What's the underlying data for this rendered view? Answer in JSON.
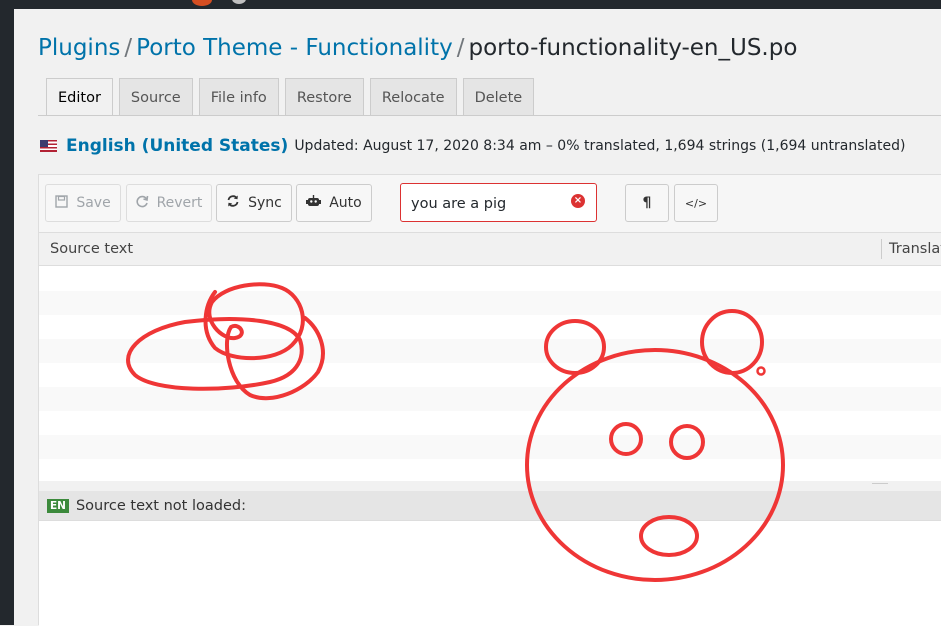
{
  "breadcrumb": {
    "plugins": "Plugins",
    "sep1": "/",
    "theme": "Porto Theme - Functionality",
    "sep2": "/",
    "file": "porto-functionality-en_US.po"
  },
  "tabs": [
    {
      "label": "Editor",
      "active": true
    },
    {
      "label": "Source",
      "active": false
    },
    {
      "label": "File info",
      "active": false
    },
    {
      "label": "Restore",
      "active": false
    },
    {
      "label": "Relocate",
      "active": false
    },
    {
      "label": "Delete",
      "active": false
    }
  ],
  "locale": {
    "language": "English (United States)",
    "meta": "Updated: August 17, 2020 8:34 am – 0% translated, 1,694 strings (1,694 untranslated)"
  },
  "toolbar": {
    "save_label": "Save",
    "revert_label": "Revert",
    "sync_label": "Sync",
    "auto_label": "Auto",
    "search_value": "you are a pig",
    "pilcrow_icon": "¶",
    "code_icon": "</>"
  },
  "columns": {
    "source": "Source text",
    "translation": "Translat"
  },
  "source_panel": {
    "badge": "EN",
    "label": "Source text not loaded:"
  },
  "colors": {
    "link": "#0073aa",
    "doodle": "#ef3636",
    "error": "#dc3232"
  }
}
